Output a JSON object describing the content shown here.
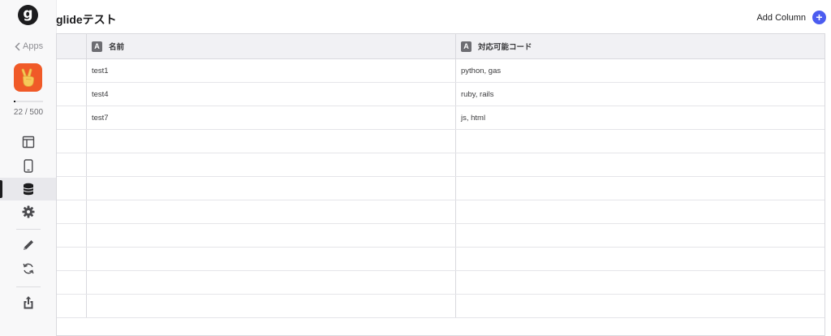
{
  "header": {
    "title": "glideテスト",
    "add_column_label": "Add Column",
    "add_column_icon": "+"
  },
  "sidebar": {
    "logo_letter": "g",
    "back_label": "Apps",
    "app_icon": "peace-hand-emoji",
    "app_icon_color": "#f05a28",
    "usage": {
      "text": "22 / 500",
      "used": 22,
      "limit": 500
    },
    "nav": [
      {
        "icon": "layout-icon",
        "active": false
      },
      {
        "icon": "phone-icon",
        "active": false
      },
      {
        "icon": "database-icon",
        "active": true
      },
      {
        "icon": "gear-icon",
        "active": false
      },
      {
        "icon": "pencil-icon",
        "active": false
      },
      {
        "icon": "sync-icon",
        "active": false
      },
      {
        "icon": "share-icon",
        "active": false
      }
    ]
  },
  "table": {
    "columns": [
      {
        "type_badge": "A",
        "name": "名前"
      },
      {
        "type_badge": "A",
        "name": "対応可能コード"
      }
    ],
    "rows": [
      [
        "test1",
        "python, gas"
      ],
      [
        "test4",
        "ruby, rails"
      ],
      [
        "test7",
        "js, html"
      ],
      [
        "",
        ""
      ],
      [
        "",
        ""
      ],
      [
        "",
        ""
      ],
      [
        "",
        ""
      ],
      [
        "",
        ""
      ],
      [
        "",
        ""
      ],
      [
        "",
        ""
      ],
      [
        "",
        ""
      ]
    ]
  },
  "colors": {
    "accent": "#4b5cf0",
    "sidebar_bg": "#f8f8f9",
    "header_bg": "#f1f1f4"
  }
}
